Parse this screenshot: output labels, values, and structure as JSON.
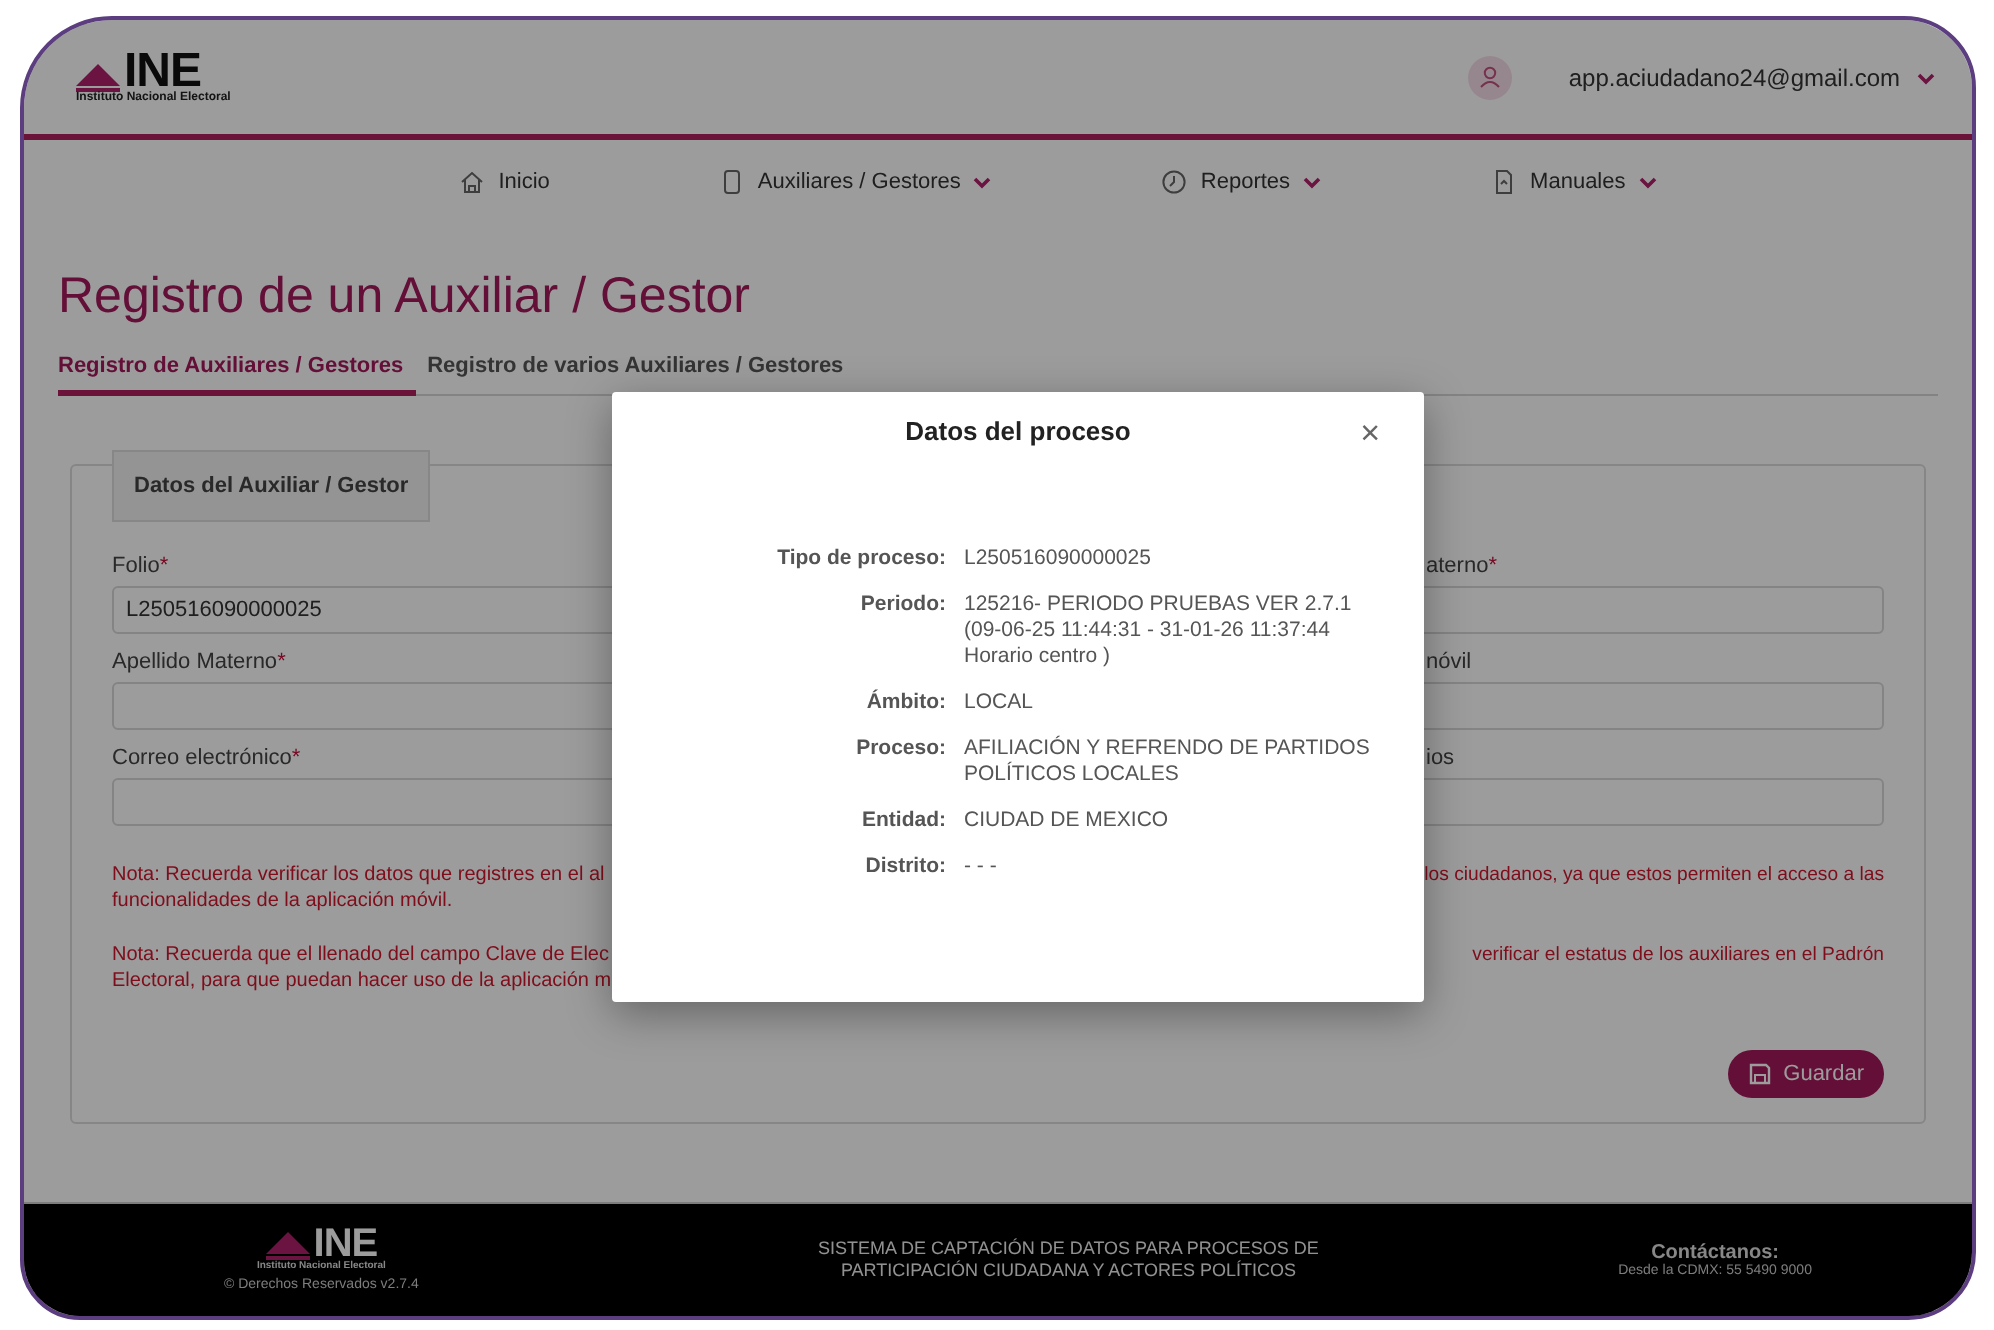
{
  "header": {
    "logo": {
      "mark": "INE",
      "subtitle": "Instituto Nacional Electoral"
    },
    "user": {
      "email": "app.aciudadano24@gmail.com",
      "has_menu": true
    }
  },
  "nav": [
    {
      "kind": "home",
      "label": "Inicio",
      "has_menu": false
    },
    {
      "kind": "phone",
      "label": "Auxiliares / Gestores",
      "has_menu": true
    },
    {
      "kind": "clock",
      "label": "Reportes",
      "has_menu": true
    },
    {
      "kind": "document",
      "label": "Manuales",
      "has_menu": true
    }
  ],
  "page_title": "Registro de un Auxiliar / Gestor",
  "tabs": [
    {
      "label": "Registro de Auxiliares / Gestores",
      "selected": true
    },
    {
      "label": "Registro de varios Auxiliares / Gestores",
      "selected": false
    }
  ],
  "form": {
    "legend": "Datos del Auxiliar / Gestor",
    "left_fields": [
      {
        "label": "Folio",
        "mark": "*",
        "value": "L250516090000025"
      },
      {
        "label": "Apellido Materno",
        "mark": "*"
      },
      {
        "label": "Correo electrónico",
        "mark": "*"
      }
    ],
    "right_fields": [
      {
        "label": "aterno",
        "mark": "*"
      },
      {
        "label": "nóvil"
      },
      {
        "label": "ios"
      }
    ],
    "notes": [
      {
        "left": "Nota: Recuerda verificar los datos que registres en el al\nfuncionalidades de la aplicación móvil.",
        "right": "los ciudadanos, ya que estos permiten el acceso a las"
      },
      {
        "left": "Nota: Recuerda que el llenado del campo Clave de Elec\nElectoral, para que puedan hacer uso de la aplicación m",
        "right": "verificar el estatus de los auxiliares en el Padrón"
      }
    ],
    "save_button": "Guardar"
  },
  "modal": {
    "title": "Datos del proceso",
    "close": "×",
    "rows": [
      {
        "label": "Tipo de proceso:",
        "value": "L250516090000025"
      },
      {
        "label": "Periodo:",
        "value": "125216- PERIODO PRUEBAS VER 2.7.1\n(09-06-25 11:44:31 - 31-01-26 11:37:44\nHorario centro )"
      },
      {
        "label": "Ámbito:",
        "value": "LOCAL"
      },
      {
        "label": "Proceso:",
        "value": "AFILIACIÓN Y REFRENDO DE PARTIDOS\nPOLÍTICOS LOCALES"
      },
      {
        "label": "Entidad:",
        "value": "CIUDAD DE MEXICO"
      },
      {
        "label": "Distrito:",
        "value": "- - -"
      }
    ]
  },
  "footer": {
    "logo": {
      "mark": "INE",
      "subtitle": "Instituto Nacional Electoral"
    },
    "rights": "© Derechos Reservados v2.7.4",
    "system": "SISTEMA DE CAPTACIÓN DE DATOS PARA PROCESOS DE\nPARTICIPACIÓN CIUDADANA Y ACTORES POLÍTICOS",
    "contact_title": "Contáctanos:",
    "contact": "Desde la CDMX: 55 5490 9000"
  }
}
